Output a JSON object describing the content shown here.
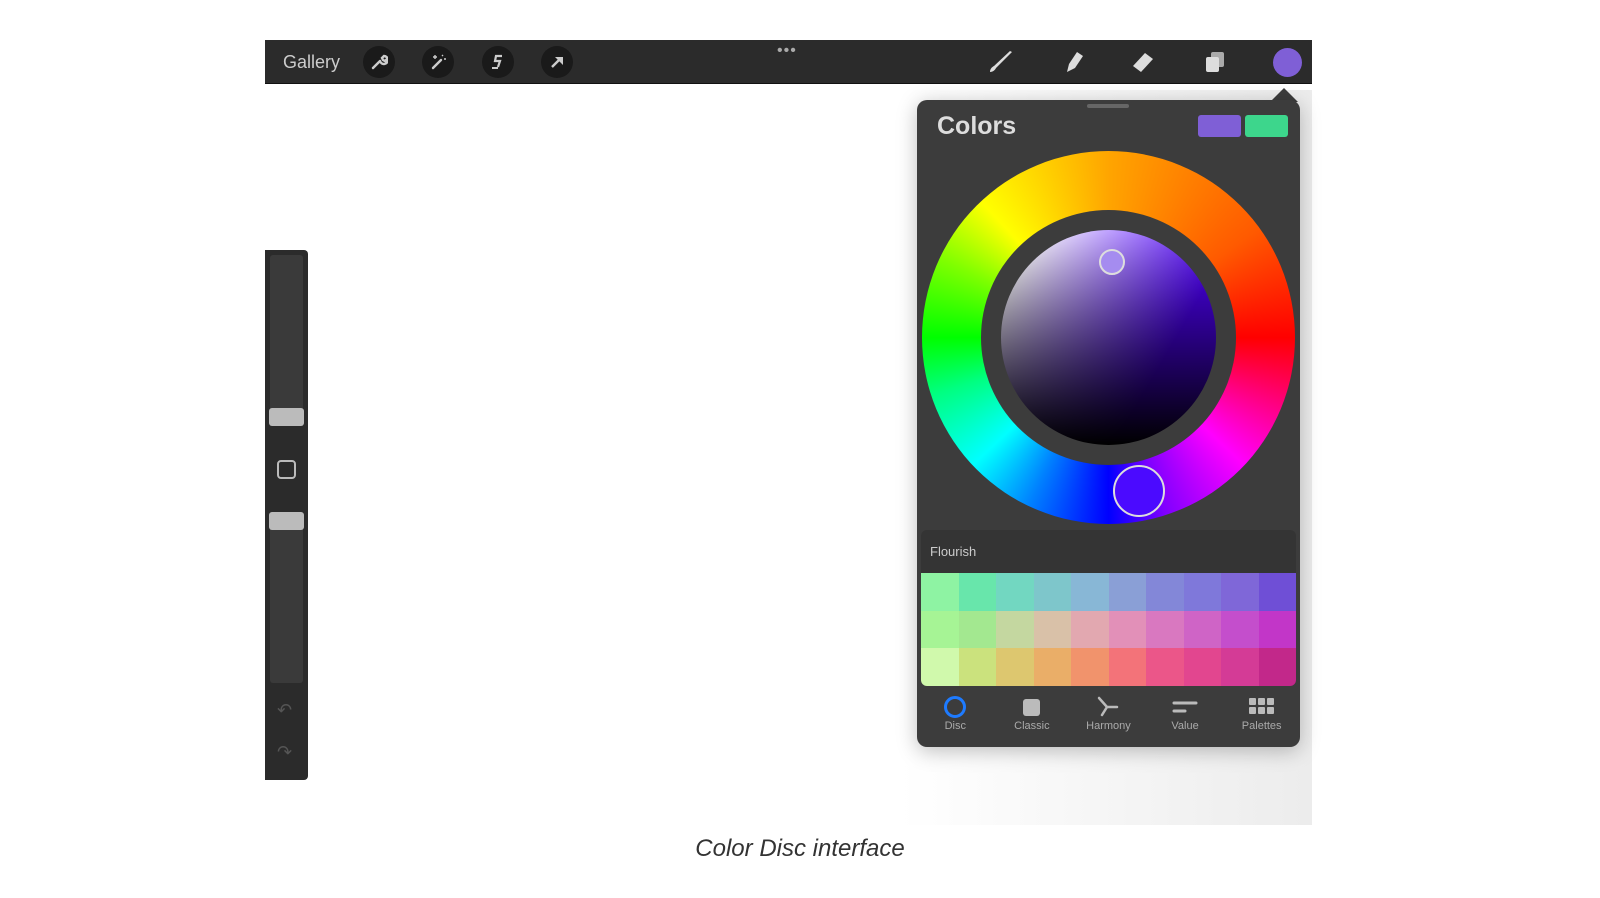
{
  "toolbar": {
    "gallery": "Gallery",
    "more": "•••",
    "tools_left": [
      "wrench-icon",
      "magic-wand-icon",
      "selection-icon",
      "transform-arrow-icon"
    ],
    "tools_right": [
      "brush-icon",
      "smudge-icon",
      "eraser-icon",
      "layers-icon",
      "color-icon"
    ],
    "current_color": "#7f5fd6"
  },
  "colors": {
    "title": "Colors",
    "primary_color": "#7f5fd6",
    "secondary_color": "#3dd68c",
    "selected_hue": "#4b0aff",
    "palette": {
      "name": "Flourish",
      "swatches": [
        [
          "#8ef3a3",
          "#68e6ab",
          "#72d7c1",
          "#7ec6cb",
          "#88b7d6",
          "#8a9fd6",
          "#8387d8",
          "#7f78da",
          "#7f67d8",
          "#6f4fd6"
        ],
        [
          "#a6f495",
          "#a3e890",
          "#c4d7a0",
          "#d9c1a8",
          "#e2a8b0",
          "#e290b8",
          "#d978c0",
          "#cf64c6",
          "#c44ecc",
          "#c236c8"
        ],
        [
          "#d0f9ac",
          "#cbe27d",
          "#ddc76f",
          "#eaae68",
          "#f1936c",
          "#f37379",
          "#eb5689",
          "#e2468f",
          "#d43b96",
          "#c2288a"
        ]
      ]
    },
    "tabs": [
      {
        "label": "Disc",
        "active": true
      },
      {
        "label": "Classic"
      },
      {
        "label": "Harmony"
      },
      {
        "label": "Value"
      },
      {
        "label": "Palettes"
      }
    ]
  },
  "caption": "Color Disc interface"
}
